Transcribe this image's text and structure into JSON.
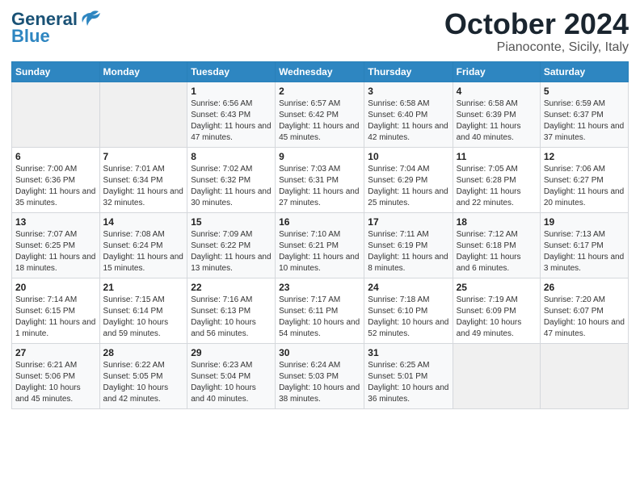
{
  "header": {
    "logo_general": "General",
    "logo_blue": "Blue",
    "month": "October 2024",
    "location": "Pianoconte, Sicily, Italy"
  },
  "weekdays": [
    "Sunday",
    "Monday",
    "Tuesday",
    "Wednesday",
    "Thursday",
    "Friday",
    "Saturday"
  ],
  "weeks": [
    [
      {
        "day": "",
        "sunrise": "",
        "sunset": "",
        "daylight": ""
      },
      {
        "day": "",
        "sunrise": "",
        "sunset": "",
        "daylight": ""
      },
      {
        "day": "1",
        "sunrise": "Sunrise: 6:56 AM",
        "sunset": "Sunset: 6:43 PM",
        "daylight": "Daylight: 11 hours and 47 minutes."
      },
      {
        "day": "2",
        "sunrise": "Sunrise: 6:57 AM",
        "sunset": "Sunset: 6:42 PM",
        "daylight": "Daylight: 11 hours and 45 minutes."
      },
      {
        "day": "3",
        "sunrise": "Sunrise: 6:58 AM",
        "sunset": "Sunset: 6:40 PM",
        "daylight": "Daylight: 11 hours and 42 minutes."
      },
      {
        "day": "4",
        "sunrise": "Sunrise: 6:58 AM",
        "sunset": "Sunset: 6:39 PM",
        "daylight": "Daylight: 11 hours and 40 minutes."
      },
      {
        "day": "5",
        "sunrise": "Sunrise: 6:59 AM",
        "sunset": "Sunset: 6:37 PM",
        "daylight": "Daylight: 11 hours and 37 minutes."
      }
    ],
    [
      {
        "day": "6",
        "sunrise": "Sunrise: 7:00 AM",
        "sunset": "Sunset: 6:36 PM",
        "daylight": "Daylight: 11 hours and 35 minutes."
      },
      {
        "day": "7",
        "sunrise": "Sunrise: 7:01 AM",
        "sunset": "Sunset: 6:34 PM",
        "daylight": "Daylight: 11 hours and 32 minutes."
      },
      {
        "day": "8",
        "sunrise": "Sunrise: 7:02 AM",
        "sunset": "Sunset: 6:32 PM",
        "daylight": "Daylight: 11 hours and 30 minutes."
      },
      {
        "day": "9",
        "sunrise": "Sunrise: 7:03 AM",
        "sunset": "Sunset: 6:31 PM",
        "daylight": "Daylight: 11 hours and 27 minutes."
      },
      {
        "day": "10",
        "sunrise": "Sunrise: 7:04 AM",
        "sunset": "Sunset: 6:29 PM",
        "daylight": "Daylight: 11 hours and 25 minutes."
      },
      {
        "day": "11",
        "sunrise": "Sunrise: 7:05 AM",
        "sunset": "Sunset: 6:28 PM",
        "daylight": "Daylight: 11 hours and 22 minutes."
      },
      {
        "day": "12",
        "sunrise": "Sunrise: 7:06 AM",
        "sunset": "Sunset: 6:27 PM",
        "daylight": "Daylight: 11 hours and 20 minutes."
      }
    ],
    [
      {
        "day": "13",
        "sunrise": "Sunrise: 7:07 AM",
        "sunset": "Sunset: 6:25 PM",
        "daylight": "Daylight: 11 hours and 18 minutes."
      },
      {
        "day": "14",
        "sunrise": "Sunrise: 7:08 AM",
        "sunset": "Sunset: 6:24 PM",
        "daylight": "Daylight: 11 hours and 15 minutes."
      },
      {
        "day": "15",
        "sunrise": "Sunrise: 7:09 AM",
        "sunset": "Sunset: 6:22 PM",
        "daylight": "Daylight: 11 hours and 13 minutes."
      },
      {
        "day": "16",
        "sunrise": "Sunrise: 7:10 AM",
        "sunset": "Sunset: 6:21 PM",
        "daylight": "Daylight: 11 hours and 10 minutes."
      },
      {
        "day": "17",
        "sunrise": "Sunrise: 7:11 AM",
        "sunset": "Sunset: 6:19 PM",
        "daylight": "Daylight: 11 hours and 8 minutes."
      },
      {
        "day": "18",
        "sunrise": "Sunrise: 7:12 AM",
        "sunset": "Sunset: 6:18 PM",
        "daylight": "Daylight: 11 hours and 6 minutes."
      },
      {
        "day": "19",
        "sunrise": "Sunrise: 7:13 AM",
        "sunset": "Sunset: 6:17 PM",
        "daylight": "Daylight: 11 hours and 3 minutes."
      }
    ],
    [
      {
        "day": "20",
        "sunrise": "Sunrise: 7:14 AM",
        "sunset": "Sunset: 6:15 PM",
        "daylight": "Daylight: 11 hours and 1 minute."
      },
      {
        "day": "21",
        "sunrise": "Sunrise: 7:15 AM",
        "sunset": "Sunset: 6:14 PM",
        "daylight": "Daylight: 10 hours and 59 minutes."
      },
      {
        "day": "22",
        "sunrise": "Sunrise: 7:16 AM",
        "sunset": "Sunset: 6:13 PM",
        "daylight": "Daylight: 10 hours and 56 minutes."
      },
      {
        "day": "23",
        "sunrise": "Sunrise: 7:17 AM",
        "sunset": "Sunset: 6:11 PM",
        "daylight": "Daylight: 10 hours and 54 minutes."
      },
      {
        "day": "24",
        "sunrise": "Sunrise: 7:18 AM",
        "sunset": "Sunset: 6:10 PM",
        "daylight": "Daylight: 10 hours and 52 minutes."
      },
      {
        "day": "25",
        "sunrise": "Sunrise: 7:19 AM",
        "sunset": "Sunset: 6:09 PM",
        "daylight": "Daylight: 10 hours and 49 minutes."
      },
      {
        "day": "26",
        "sunrise": "Sunrise: 7:20 AM",
        "sunset": "Sunset: 6:07 PM",
        "daylight": "Daylight: 10 hours and 47 minutes."
      }
    ],
    [
      {
        "day": "27",
        "sunrise": "Sunrise: 6:21 AM",
        "sunset": "Sunset: 5:06 PM",
        "daylight": "Daylight: 10 hours and 45 minutes."
      },
      {
        "day": "28",
        "sunrise": "Sunrise: 6:22 AM",
        "sunset": "Sunset: 5:05 PM",
        "daylight": "Daylight: 10 hours and 42 minutes."
      },
      {
        "day": "29",
        "sunrise": "Sunrise: 6:23 AM",
        "sunset": "Sunset: 5:04 PM",
        "daylight": "Daylight: 10 hours and 40 minutes."
      },
      {
        "day": "30",
        "sunrise": "Sunrise: 6:24 AM",
        "sunset": "Sunset: 5:03 PM",
        "daylight": "Daylight: 10 hours and 38 minutes."
      },
      {
        "day": "31",
        "sunrise": "Sunrise: 6:25 AM",
        "sunset": "Sunset: 5:01 PM",
        "daylight": "Daylight: 10 hours and 36 minutes."
      },
      {
        "day": "",
        "sunrise": "",
        "sunset": "",
        "daylight": ""
      },
      {
        "day": "",
        "sunrise": "",
        "sunset": "",
        "daylight": ""
      }
    ]
  ]
}
